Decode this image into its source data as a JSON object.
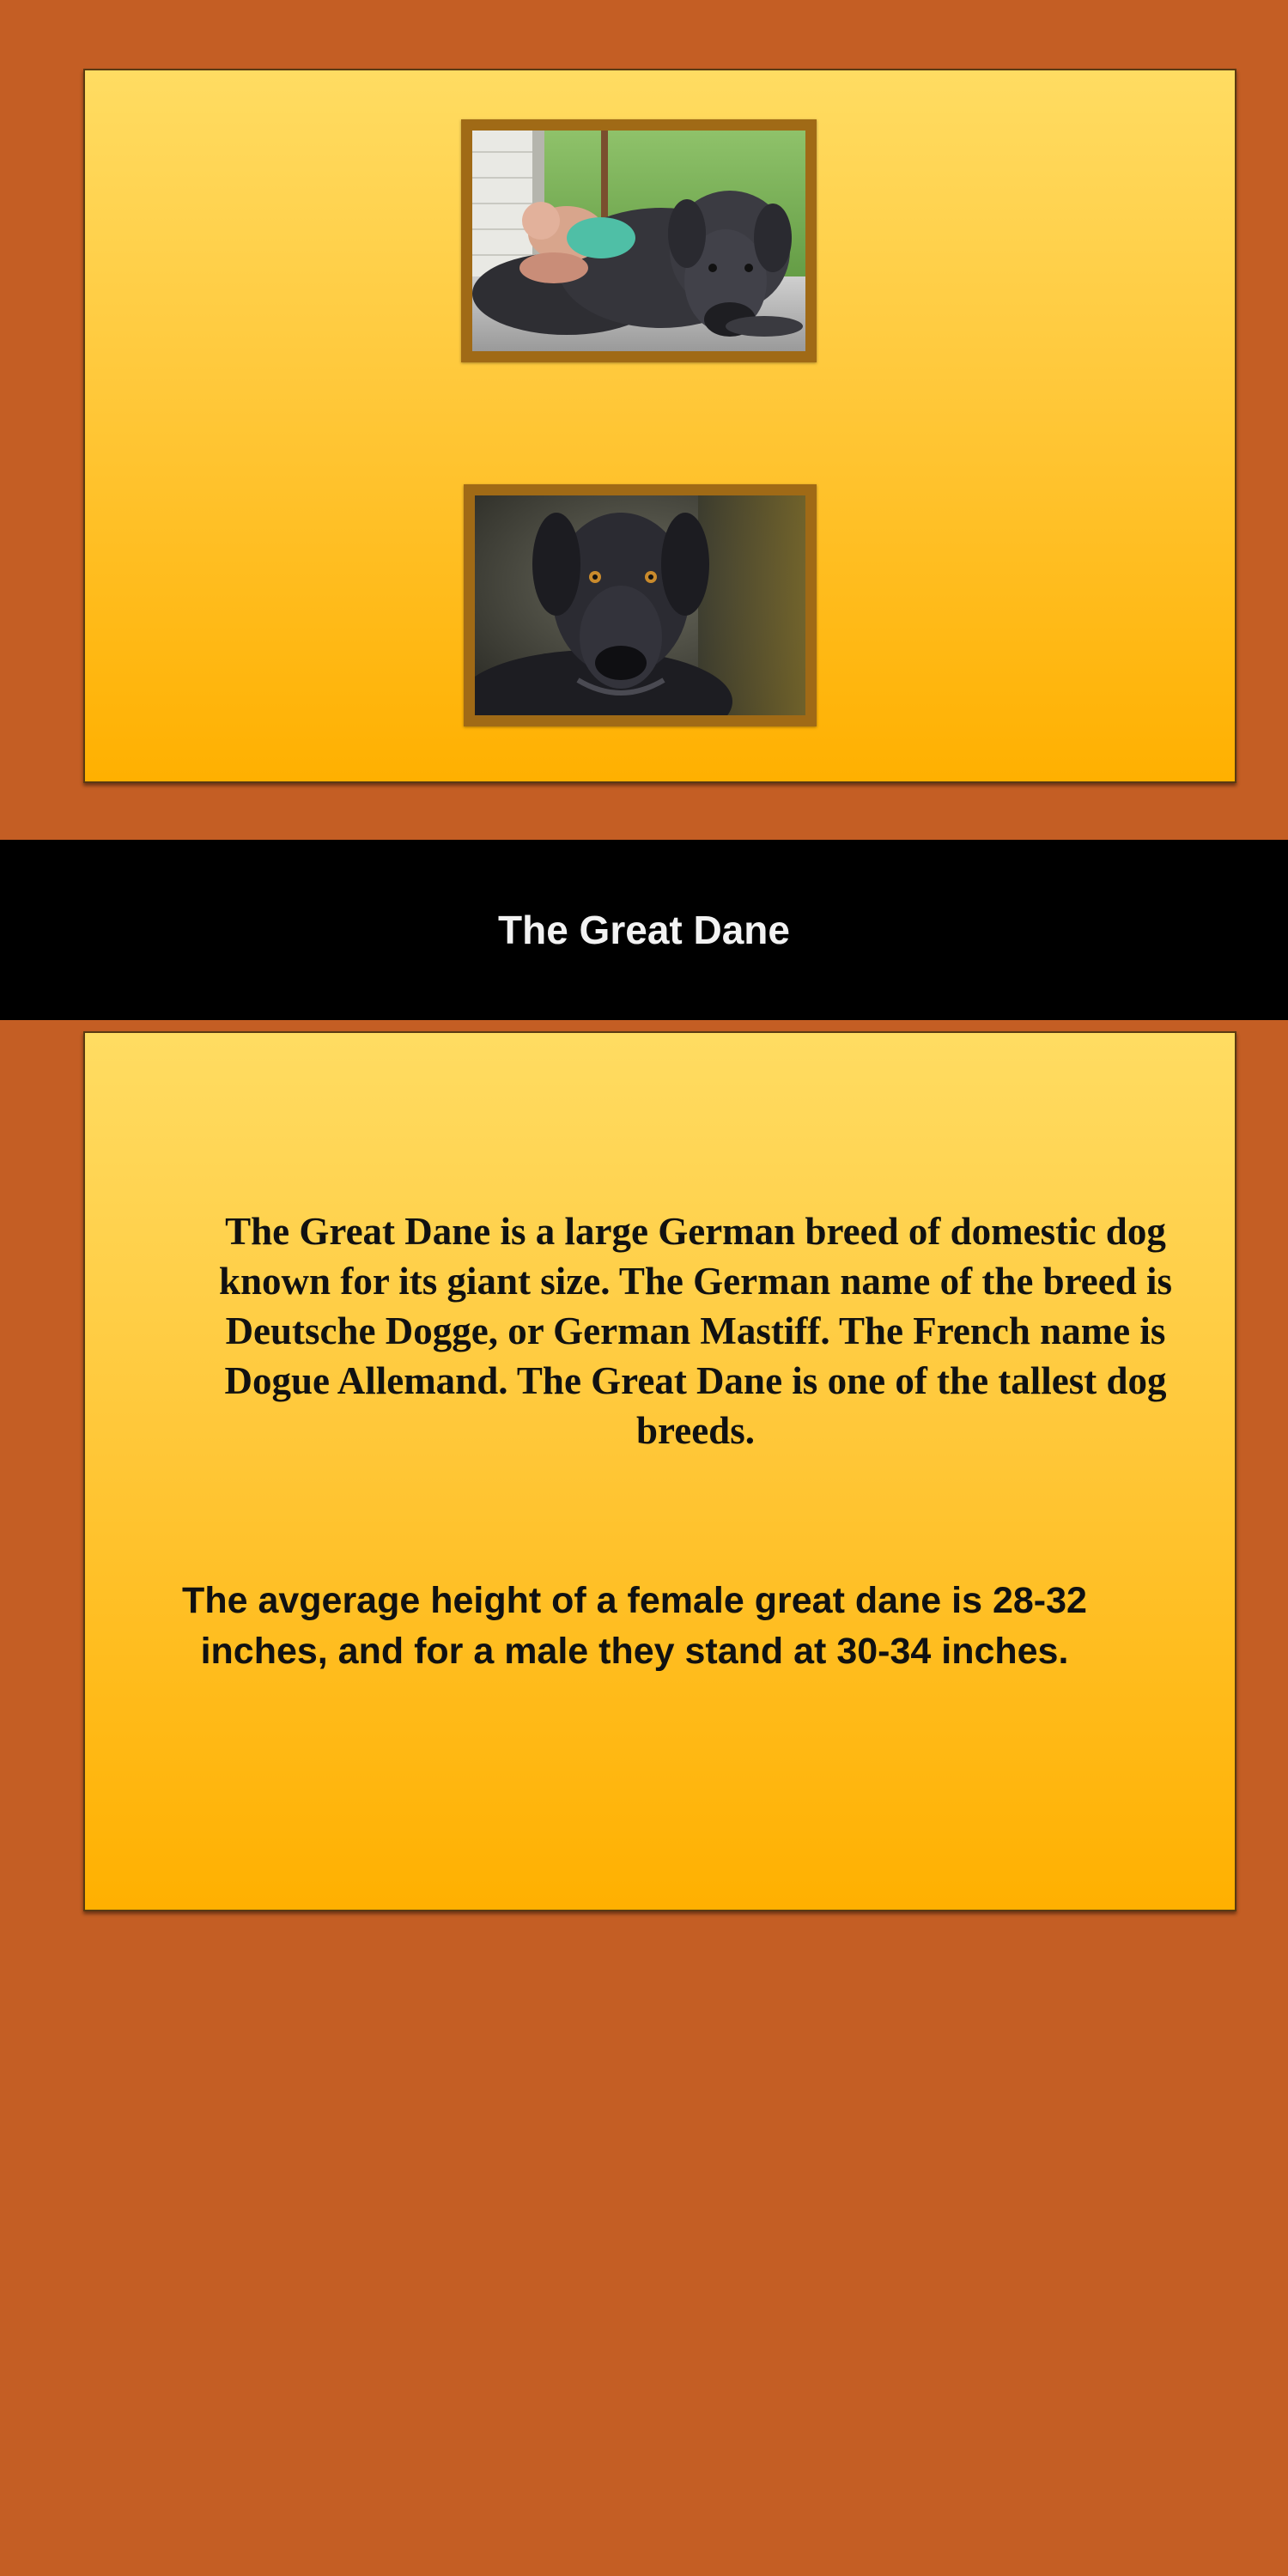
{
  "title": "The Great Dane",
  "photos": [
    {
      "description": "Great Dane lying down next to a sleeping baby"
    },
    {
      "description": "Close-up of a black Great Dane's face"
    }
  ],
  "content": {
    "description": "The Great Dane is a large German breed of domestic dog known for its giant size. The German name of the breed is Deutsche Dogge, or German Mastiff. The French name is Dogue Allemand. The Great Dane is one of the tallest dog breeds.",
    "height_fact": "The avgerage height of a female great dane is 28-32 inches, and for a male they stand at 30-34 inches."
  },
  "colors": {
    "background": "#c45e24",
    "panel_top": "#ffdc62",
    "panel_bottom": "#ffb000",
    "title_bar": "#000000",
    "title_text": "#f2f2f2",
    "frame": "#a06a16"
  }
}
